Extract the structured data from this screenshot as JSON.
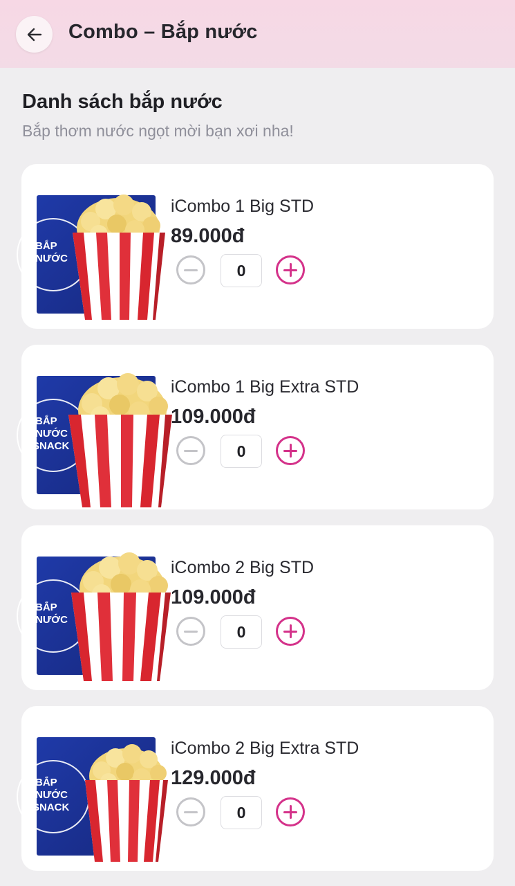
{
  "header": {
    "title": "Combo – Bắp nước",
    "back_icon": "arrow-left-icon"
  },
  "section": {
    "title": "Danh sách bắp nước",
    "subtitle": "Bắp thơm nước ngọt mời bạn xơi nha!"
  },
  "products": [
    {
      "name": "iCombo 1 Big STD",
      "price": "89.000đ",
      "quantity": "0",
      "image_text": [
        "BẮP",
        "NƯỚC"
      ]
    },
    {
      "name": "iCombo 1 Big Extra STD",
      "price": "109.000đ",
      "quantity": "0",
      "image_text": [
        "BẮP",
        "NƯỚC",
        "SNACK"
      ]
    },
    {
      "name": "iCombo 2 Big STD",
      "price": "109.000đ",
      "quantity": "0",
      "image_text": [
        "BẮP",
        "NƯỚC"
      ]
    },
    {
      "name": "iCombo 2 Big Extra STD",
      "price": "129.000đ",
      "quantity": "0",
      "image_text": [
        "BẮP",
        "NƯỚC",
        "SNACK"
      ]
    }
  ],
  "colors": {
    "header_bg": "#f7d8e5",
    "accent": "#d4328a",
    "disabled": "#c4c4c8",
    "page_bg": "#efeef0"
  }
}
